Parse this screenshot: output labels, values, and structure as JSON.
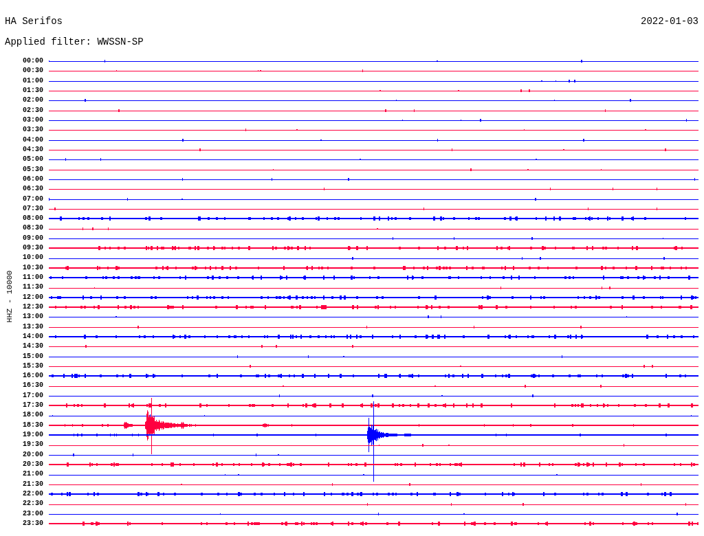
{
  "header": {
    "station": "HA Serifos",
    "date": "2022-01-03",
    "filter": "Applied filter: WWSSN-SP"
  },
  "plot": {
    "axis_label": "HHZ - 10000",
    "rows": [
      {
        "time": "00:00",
        "color": "#0000ff",
        "kind": "quiet"
      },
      {
        "time": "00:30",
        "color": "#ff0040",
        "kind": "quiet"
      },
      {
        "time": "01:00",
        "color": "#0000ff",
        "kind": "quiet"
      },
      {
        "time": "01:30",
        "color": "#ff0040",
        "kind": "quiet"
      },
      {
        "time": "02:00",
        "color": "#0000ff",
        "kind": "quiet"
      },
      {
        "time": "02:30",
        "color": "#ff0040",
        "kind": "quiet"
      },
      {
        "time": "03:00",
        "color": "#0000ff",
        "kind": "quiet"
      },
      {
        "time": "03:30",
        "color": "#ff0040",
        "kind": "quiet"
      },
      {
        "time": "04:00",
        "color": "#0000ff",
        "kind": "quiet"
      },
      {
        "time": "04:30",
        "color": "#ff0040",
        "kind": "quiet"
      },
      {
        "time": "05:00",
        "color": "#0000ff",
        "kind": "quiet"
      },
      {
        "time": "05:30",
        "color": "#ff0040",
        "kind": "quiet"
      },
      {
        "time": "06:00",
        "color": "#0000ff",
        "kind": "quiet"
      },
      {
        "time": "06:30",
        "color": "#ff0040",
        "kind": "quiet"
      },
      {
        "time": "07:00",
        "color": "#0000ff",
        "kind": "quiet"
      },
      {
        "time": "07:30",
        "color": "#ff0040",
        "kind": "quiet"
      },
      {
        "time": "08:00",
        "color": "#0000ff",
        "kind": "noisy"
      },
      {
        "time": "08:30",
        "color": "#ff0040",
        "kind": "quiet"
      },
      {
        "time": "09:00",
        "color": "#0000ff",
        "kind": "quiet"
      },
      {
        "time": "09:30",
        "color": "#ff0040",
        "kind": "noisy"
      },
      {
        "time": "10:00",
        "color": "#0000ff",
        "kind": "quiet"
      },
      {
        "time": "10:30",
        "color": "#ff0040",
        "kind": "noisy"
      },
      {
        "time": "11:00",
        "color": "#0000ff",
        "kind": "noisy"
      },
      {
        "time": "11:30",
        "color": "#ff0040",
        "kind": "quiet"
      },
      {
        "time": "12:00",
        "color": "#0000ff",
        "kind": "noisy"
      },
      {
        "time": "12:30",
        "color": "#ff0040",
        "kind": "noisy"
      },
      {
        "time": "13:00",
        "color": "#0000ff",
        "kind": "quiet"
      },
      {
        "time": "13:30",
        "color": "#ff0040",
        "kind": "quiet"
      },
      {
        "time": "14:00",
        "color": "#0000ff",
        "kind": "noisy"
      },
      {
        "time": "14:30",
        "color": "#ff0040",
        "kind": "quiet"
      },
      {
        "time": "15:00",
        "color": "#0000ff",
        "kind": "quiet"
      },
      {
        "time": "15:30",
        "color": "#ff0040",
        "kind": "quiet"
      },
      {
        "time": "16:00",
        "color": "#0000ff",
        "kind": "noisy"
      },
      {
        "time": "16:30",
        "color": "#ff0040",
        "kind": "quiet"
      },
      {
        "time": "17:00",
        "color": "#0000ff",
        "kind": "quiet"
      },
      {
        "time": "17:30",
        "color": "#ff0040",
        "kind": "noisy"
      },
      {
        "time": "18:00",
        "color": "#0000ff",
        "kind": "quiet"
      },
      {
        "time": "18:30",
        "color": "#ff0040",
        "kind": "event"
      },
      {
        "time": "19:00",
        "color": "#0000ff",
        "kind": "event"
      },
      {
        "time": "19:30",
        "color": "#ff0040",
        "kind": "quiet"
      },
      {
        "time": "20:00",
        "color": "#0000ff",
        "kind": "quiet"
      },
      {
        "time": "20:30",
        "color": "#ff0040",
        "kind": "noisy"
      },
      {
        "time": "21:00",
        "color": "#0000ff",
        "kind": "quiet"
      },
      {
        "time": "21:30",
        "color": "#ff0040",
        "kind": "quiet"
      },
      {
        "time": "22:00",
        "color": "#0000ff",
        "kind": "noisy"
      },
      {
        "time": "22:30",
        "color": "#ff0040",
        "kind": "quiet"
      },
      {
        "time": "23:00",
        "color": "#0000ff",
        "kind": "quiet"
      },
      {
        "time": "23:30",
        "color": "#ff0040",
        "kind": "noisy"
      }
    ]
  }
}
